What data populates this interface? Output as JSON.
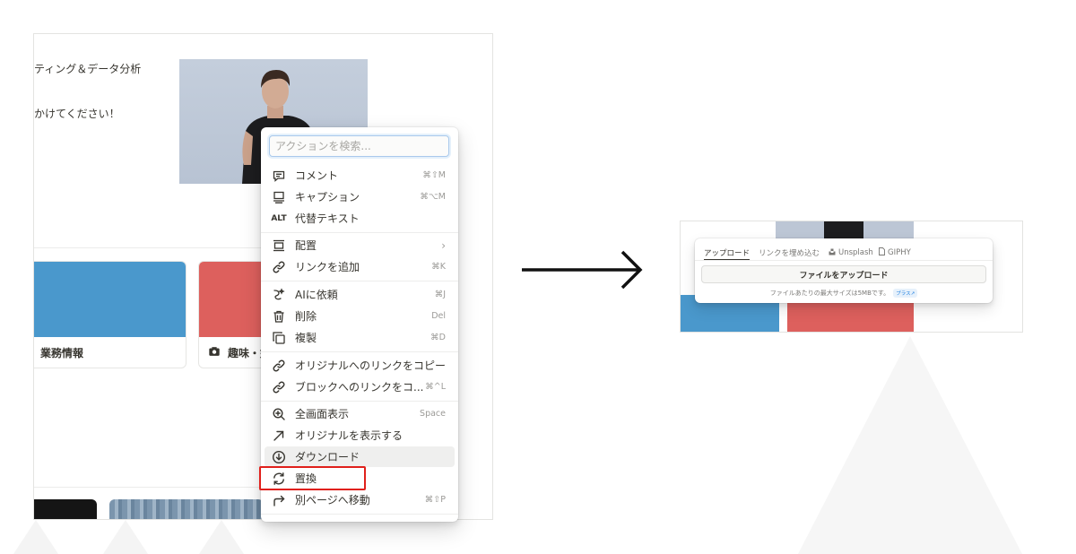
{
  "colors": {
    "card_blue": "#4a98cc",
    "card_red": "#dd605d",
    "highlight_red": "#e0201b",
    "badge_blue": "#2383e2"
  },
  "page": {
    "text_line_1": "ティング＆データ分析",
    "text_line_2": "かけてください！",
    "cards": [
      {
        "label": "業務情報",
        "icon": "briefcase-icon"
      },
      {
        "label": "趣味・好",
        "icon": "camera-icon"
      }
    ]
  },
  "context_menu": {
    "search_placeholder": "アクションを検索...",
    "items": [
      {
        "label": "コメント",
        "shortcut": "⌘⇧M",
        "icon": "comment-icon"
      },
      {
        "label": "キャプション",
        "shortcut": "⌘⌥M",
        "icon": "caption-icon"
      },
      {
        "label": "代替テキスト",
        "shortcut": "",
        "icon": "alt-text-icon",
        "icon_text": "ALT"
      },
      {
        "label": "配置",
        "shortcut": "",
        "icon": "align-icon"
      },
      {
        "label": "リンクを追加",
        "shortcut": "⌘K",
        "icon": "link-icon"
      },
      {
        "label": "AIに依頼",
        "shortcut": "⌘J",
        "icon": "ai-icon"
      },
      {
        "label": "削除",
        "shortcut": "Del",
        "icon": "trash-icon"
      },
      {
        "label": "複製",
        "shortcut": "⌘D",
        "icon": "duplicate-icon"
      },
      {
        "label": "オリジナルへのリンクをコピー",
        "shortcut": "",
        "icon": "link-icon"
      },
      {
        "label": "ブロックへのリンクをコ...",
        "shortcut": "⌘^L",
        "icon": "link-icon"
      },
      {
        "label": "全画面表示",
        "shortcut": "Space",
        "icon": "zoom-in-icon"
      },
      {
        "label": "オリジナルを表示する",
        "shortcut": "",
        "icon": "arrow-up-right-icon"
      },
      {
        "label": "ダウンロード",
        "shortcut": "",
        "icon": "download-icon"
      },
      {
        "label": "置換",
        "shortcut": "",
        "icon": "replace-icon"
      },
      {
        "label": "別ページへ移動",
        "shortcut": "⌘⇧P",
        "icon": "move-to-icon"
      }
    ]
  },
  "upload_popup": {
    "tabs": [
      {
        "label": "アップロード",
        "active": true
      },
      {
        "label": "リンクを埋め込む",
        "active": false
      },
      {
        "label": "Unsplash",
        "active": false,
        "icon": "unsplash-icon"
      },
      {
        "label": "GIPHY",
        "active": false,
        "icon": "file-icon"
      }
    ],
    "upload_button_label": "ファイルをアップロード",
    "note": "ファイルあたりの最大サイズは5MBです。",
    "plus_badge": "プラス↗"
  }
}
